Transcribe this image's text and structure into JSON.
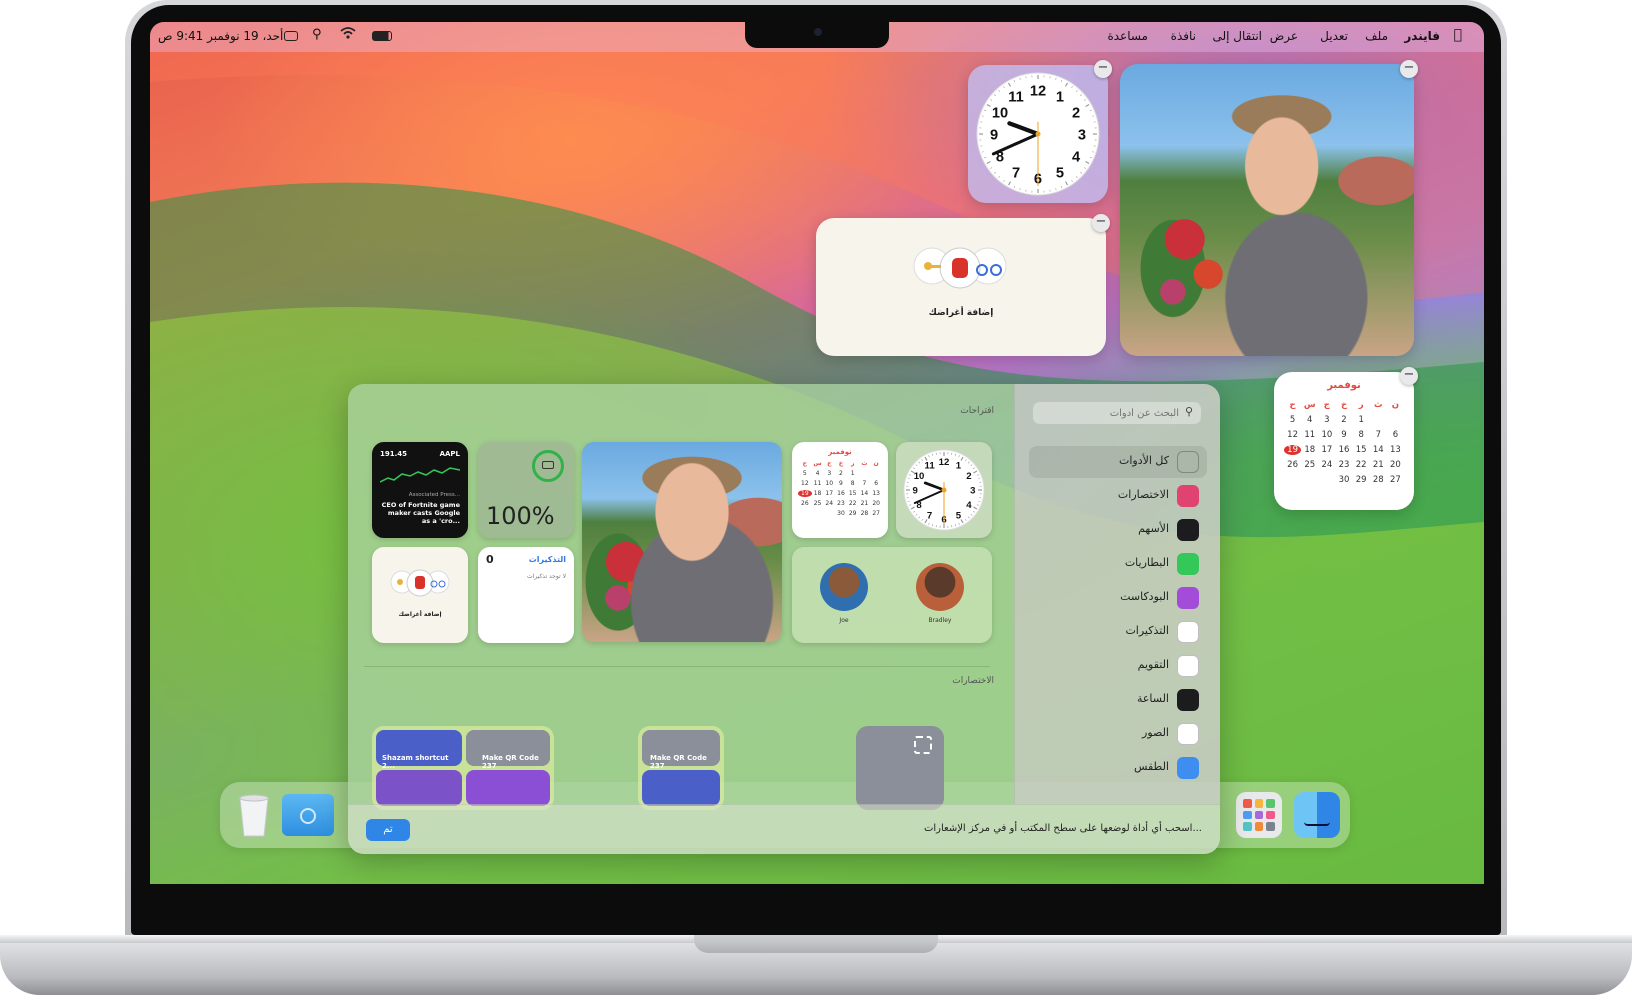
{
  "menubar": {
    "apple_icon": "apple-logo",
    "app_name": "فايندر",
    "menus": [
      "ملف",
      "تعديل",
      "عرض",
      "انتقال إلى",
      "نافذة",
      "مساعدة"
    ],
    "datetime": "أحد، 19 نوفمبر 9:41 ص",
    "icons": [
      "battery-icon",
      "wifi-icon",
      "search-icon",
      "control-center-icon"
    ]
  },
  "desktop": {
    "clock_widget": {
      "numbers": [
        "12",
        "1",
        "2",
        "3",
        "4",
        "5",
        "6",
        "7",
        "8",
        "9",
        "10",
        "11"
      ],
      "time": "9:41"
    },
    "airtag_widget": {
      "label": "إضافة أغراضك"
    },
    "calendar_widget": {
      "month": "نوفمبر",
      "weekdays": [
        "ن",
        "ث",
        "ر",
        "خ",
        "ج",
        "س",
        "ح"
      ],
      "rows": [
        [
          "",
          "",
          "1",
          "2",
          "3",
          "4",
          "5"
        ],
        [
          "6",
          "7",
          "8",
          "9",
          "10",
          "11",
          "12"
        ],
        [
          "13",
          "14",
          "15",
          "16",
          "17",
          "18",
          "19"
        ],
        [
          "20",
          "21",
          "22",
          "23",
          "24",
          "25",
          "26"
        ],
        [
          "27",
          "28",
          "29",
          "30",
          "",
          "",
          ""
        ]
      ],
      "today": "19"
    }
  },
  "gallery": {
    "search": {
      "placeholder": "البحث عن أدوات"
    },
    "section_suggestions": "اقتراحات",
    "section_shortcuts": "الاختصارات",
    "sidebar": [
      {
        "label": "كل الأدوات",
        "icon": "all-widgets-icon",
        "color": "transparent"
      },
      {
        "label": "الاختصارات",
        "icon": "shortcuts-icon",
        "color": "#e0436f"
      },
      {
        "label": "الأسهم",
        "icon": "stocks-icon",
        "color": "#1c1c1e"
      },
      {
        "label": "البطاريات",
        "icon": "batteries-icon",
        "color": "#34c759"
      },
      {
        "label": "البودكاست",
        "icon": "podcasts-icon",
        "color": "#a34cd9"
      },
      {
        "label": "التذكيرات",
        "icon": "reminders-icon",
        "color": "#ffffff"
      },
      {
        "label": "التقويم",
        "icon": "calendar-icon",
        "color": "#ffffff"
      },
      {
        "label": "الساعة",
        "icon": "clock-icon",
        "color": "#1c1c1e"
      },
      {
        "label": "الصور",
        "icon": "photos-icon",
        "color": "#ffffff"
      },
      {
        "label": "الطقس",
        "icon": "weather-icon",
        "color": "#3d8ef0"
      }
    ],
    "stocks": {
      "ticker": "AAPL",
      "price": "191.45",
      "source": "Associated Press...",
      "headline": "CEO of Fortnite game maker casts Google as a 'cro..."
    },
    "battery": {
      "percent": "100%",
      "level": 1.0
    },
    "reminders": {
      "title": "التذكيرات",
      "count": "0",
      "empty": "لا توجد تذكيرات"
    },
    "airtag": {
      "label": "إضافة أغراضك"
    },
    "contacts": [
      {
        "name": "Joe"
      },
      {
        "name": "Bradley"
      }
    ],
    "shortcuts": [
      {
        "label": "Shazam shortcut 2...",
        "color": "#4a5fc8"
      },
      {
        "label": "Make QR Code 237",
        "color": "#8a8f99"
      },
      {
        "label": "Make QR Code 237",
        "color": "#8a8f99"
      }
    ],
    "footer": {
      "hint": "اسحب أي أداة لوضعها على سطح المكتب أو في مركز الإشعارات...",
      "done": "تم"
    }
  },
  "dock": {
    "items": [
      "trash-icon",
      "downloads-folder-icon",
      "launchpad-icon",
      "finder-icon"
    ]
  }
}
